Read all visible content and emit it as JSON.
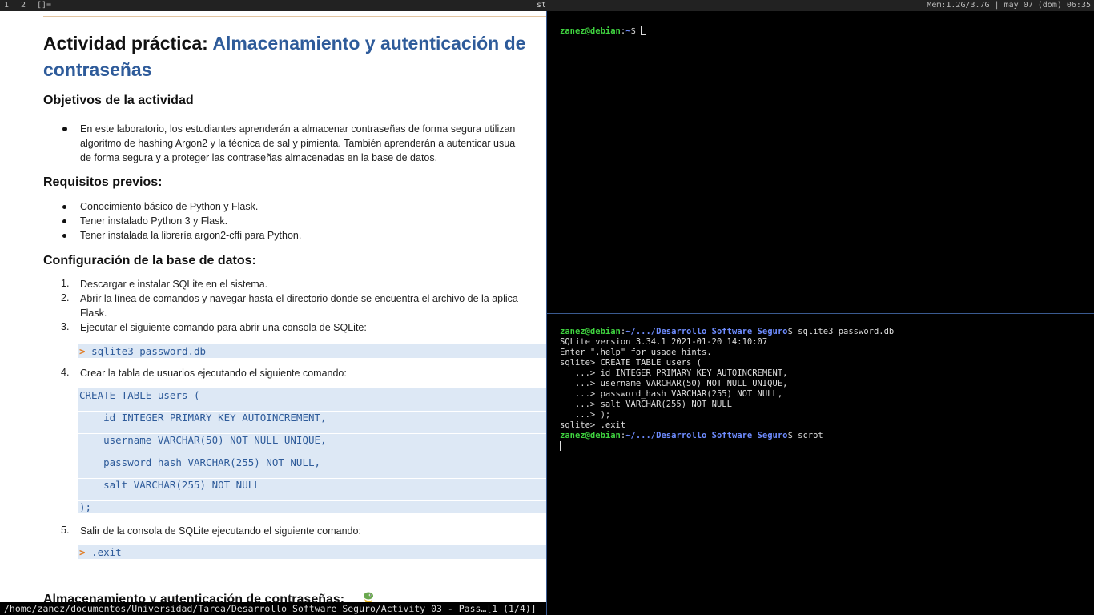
{
  "topbar": {
    "workspaces": [
      "1",
      "2"
    ],
    "layout": "[]=",
    "window_title": "st",
    "status": "Mem:1.2G/3.7G | may 07 (dom) 06:35"
  },
  "document": {
    "title_prefix": "Actividad práctica: ",
    "title_blue_1": "Almacenamiento y autenticación de",
    "title_blue_2": "contraseñas",
    "objectives_heading": "Objetivos de la actividad",
    "objectives_lines": [
      "En este laboratorio, los estudiantes aprenderán a almacenar contraseñas de forma segura utilizan",
      "algoritmo de hashing Argon2 y la técnica de sal y pimienta. También aprenderán a autenticar usua",
      "de forma segura y a proteger las contraseñas almacenadas en la base de datos."
    ],
    "prereq_heading": "Requisitos previos:",
    "prereq_items": [
      "Conocimiento básico de Python y Flask.",
      "Tener instalado Python 3 y Flask.",
      "Tener instalada la librería argon2-cffi para Python."
    ],
    "config_heading": "Configuración de la base de datos:",
    "steps": [
      {
        "num": "1.",
        "lines": [
          "Descargar e instalar SQLite en el sistema."
        ]
      },
      {
        "num": "2.",
        "lines": [
          "Abrir la línea de comandos y navegar hasta el directorio donde se encuentra el archivo de la aplica",
          "Flask."
        ]
      },
      {
        "num": "3.",
        "lines": [
          "Ejecutar el siguiente comando para abrir una consola de SQLite:"
        ]
      },
      {
        "num": "4.",
        "lines": [
          "Crear la tabla de usuarios ejecutando el siguiente comando:"
        ]
      },
      {
        "num": "5.",
        "lines": [
          "Salir de la consola de SQLite ejecutando el siguiente comando:"
        ]
      }
    ],
    "prompt_glyph": ">",
    "cmd_sqlite": "sqlite3 password.db",
    "sql_lines": [
      "CREATE TABLE users (",
      "    id INTEGER PRIMARY KEY AUTOINCREMENT,",
      "    username VARCHAR(50) NOT NULL UNIQUE,",
      "    password_hash VARCHAR(255) NOT NULL,",
      "    salt VARCHAR(255) NOT NULL",
      ");"
    ],
    "cmd_exit": ".exit",
    "next_heading": "Almacenamiento y autenticación de contraseñas:"
  },
  "doc_status": "/home/zanez/documentos/Universidad/Tarea/Desarrollo Software Seguro/Activity 03 - Pass…[1 (1/4)]",
  "term1": {
    "user": "zanez@debian",
    "sep": ":",
    "path": "~",
    "prompt_end": "$ "
  },
  "term2": {
    "user": "zanez@debian",
    "sep": ":",
    "path": "~/.../Desarrollo Software Seguro",
    "prompt_end": "$ ",
    "cmd1": "sqlite3 password.db",
    "output": [
      "SQLite version 3.34.1 2021-01-20 14:10:07",
      "Enter \".help\" for usage hints.",
      "sqlite> CREATE TABLE users (",
      "   ...> id INTEGER PRIMARY KEY AUTOINCREMENT,",
      "   ...> username VARCHAR(50) NOT NULL UNIQUE,",
      "   ...> password_hash VARCHAR(255) NOT NULL,",
      "   ...> salt VARCHAR(255) NOT NULL",
      "   ...> );",
      "sqlite> .exit"
    ],
    "cmd2": "scrot"
  },
  "colors": {
    "accent_blue": "#2e5b9a",
    "prompt_orange": "#e07a20",
    "code_bg": "#dde8f5",
    "term_user": "#3fd23f",
    "term_path": "#6e8cff"
  }
}
